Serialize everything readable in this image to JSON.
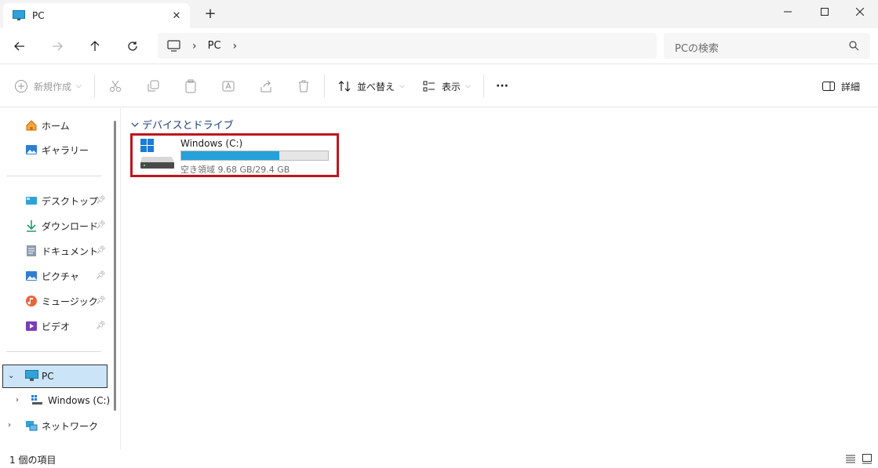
{
  "tab": {
    "title": "PC",
    "close_label": "✕",
    "new_tab_label": "+"
  },
  "address": {
    "crumb": "PC",
    "separator": "›",
    "trailing_separator": "›"
  },
  "search": {
    "placeholder": "PCの検索"
  },
  "toolbar": {
    "new_label": "新規作成",
    "sort_label": "並べ替え",
    "view_label": "表示",
    "more_label": "···",
    "details_label": "詳細"
  },
  "sidebar": {
    "home": "ホーム",
    "gallery": "ギャラリー",
    "quick": [
      {
        "label": "デスクトップ",
        "icon": "desktop-icon"
      },
      {
        "label": "ダウンロード",
        "icon": "download-icon"
      },
      {
        "label": "ドキュメント",
        "icon": "document-icon"
      },
      {
        "label": "ピクチャ",
        "icon": "picture-icon"
      },
      {
        "label": "ミュージック",
        "icon": "music-icon"
      },
      {
        "label": "ビデオ",
        "icon": "video-icon"
      }
    ],
    "pc": "PC",
    "drive": "Windows (C:)",
    "network": "ネットワーク"
  },
  "content": {
    "group_title": "デバイスとドライブ",
    "drive": {
      "name": "Windows (C:)",
      "free_text": "空き領域 9.68 GB/29.4 GB",
      "used_fraction": 0.67
    }
  },
  "status": {
    "item_count": "1 個の項目"
  },
  "colors": {
    "accent": "#26a0da",
    "highlight": "#c0141f",
    "selection": "#cce4f7",
    "group_title": "#1c3f77"
  }
}
